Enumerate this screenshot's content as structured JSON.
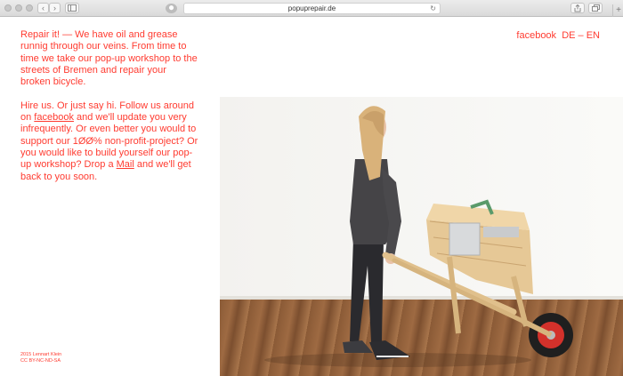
{
  "browser": {
    "url": "popuprepair.de",
    "back_icon": "chevron-left-icon",
    "forward_icon": "chevron-right-icon",
    "sidebar_icon": "sidebar-icon",
    "reload_icon": "reload-icon",
    "share_icon": "share-icon",
    "tabs_icon": "tabs-icon",
    "new_tab_icon": "plus-icon"
  },
  "intro": {
    "p1": "Repair it! — We have oil and grease runnig through our veins. From time to time we take our pop-up workshop to the streets of Bremen and repair your broken bicycle.",
    "p2_before": "Hire us. Or just say hi. Follow us around on ",
    "p2_link": "facebook",
    "p2_middle": " and we'll update you very infrequently. Or even better you would to support our 1ØØ% non-profit-project? Or you would like to build yourself our pop-up workshop? Drop a ",
    "p2_mail": "Mail",
    "p2_after": " and we'll get back to you soon."
  },
  "nav": {
    "facebook": "facebook",
    "de": "DE",
    "sep": "–",
    "en": "EN"
  },
  "footer": {
    "line1": "2015 Lennart Klein",
    "line2": "CC BY-NC-ND-SA"
  },
  "colors": {
    "accent": "#ff3b30"
  }
}
